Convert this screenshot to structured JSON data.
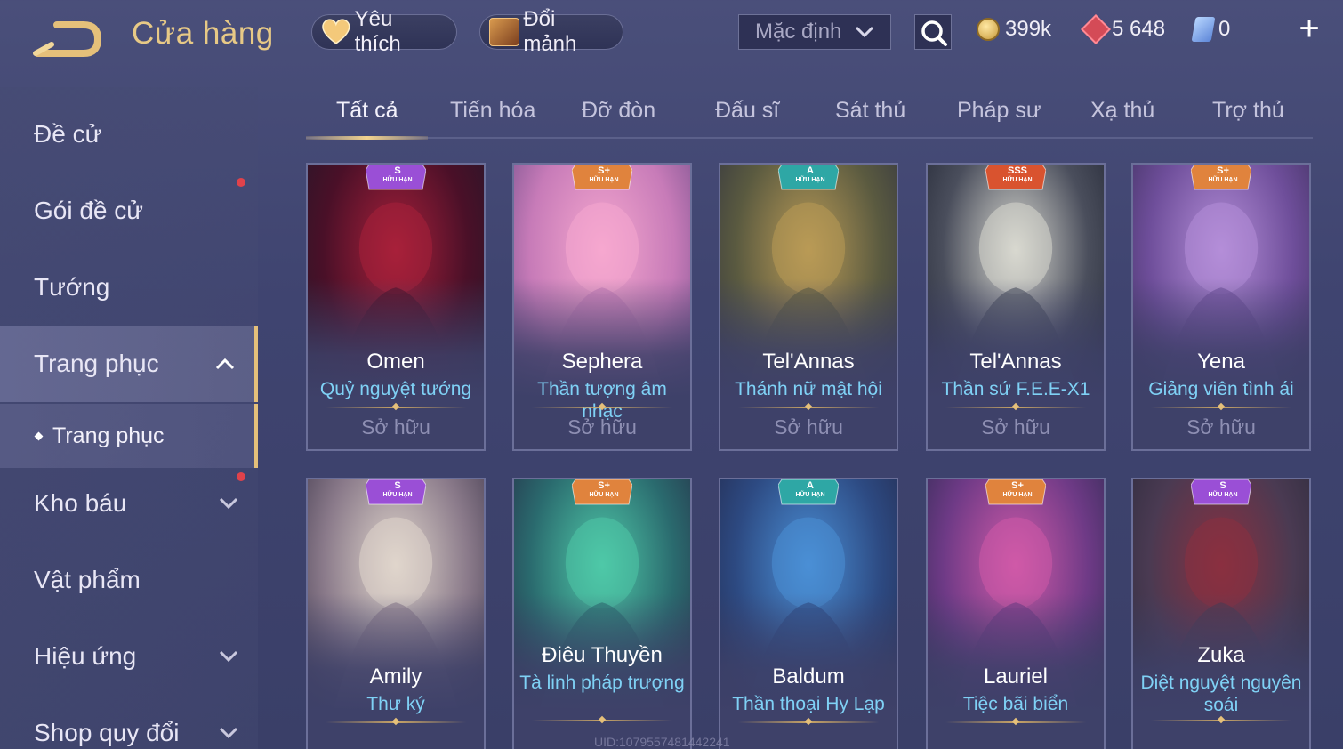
{
  "header": {
    "title": "Cửa hàng",
    "favorite_label": "Yêu thích",
    "exchange_label": "Đổi mảnh",
    "sort_label": "Mặc định",
    "currencies": {
      "gold": "399k",
      "gems": "5 648",
      "vouchers": "0"
    }
  },
  "sidebar": {
    "items": [
      {
        "label": "Đề cử"
      },
      {
        "label": "Gói đề cử"
      },
      {
        "label": "Tướng"
      },
      {
        "label": "Trang phục"
      },
      {
        "label": "Trang phục"
      },
      {
        "label": "Kho báu"
      },
      {
        "label": "Vật phẩm"
      },
      {
        "label": "Hiệu ứng"
      },
      {
        "label": "Shop quy đổi"
      }
    ]
  },
  "tabs": [
    "Tất cả",
    "Tiến hóa",
    "Đỡ đòn",
    "Đấu sĩ",
    "Sát thủ",
    "Pháp sư",
    "Xạ thủ",
    "Trợ thủ"
  ],
  "badge_sub": "HỮU HẠN",
  "cards": [
    {
      "hero": "Omen",
      "skin": "Quỷ nguyệt tướng",
      "status": "Sở hữu",
      "tier": "S",
      "badge_color": "#9a4fd6",
      "palette": [
        "#a8203a",
        "#4a1028",
        "#20182a"
      ]
    },
    {
      "hero": "Sephera",
      "skin": "Thần tượng âm nhạc",
      "status": "Sở hữu",
      "tier": "S+",
      "badge_color": "#e0833d",
      "palette": [
        "#f6a8cf",
        "#c77bb8",
        "#6a4a86"
      ]
    },
    {
      "hero": "Tel'Annas",
      "skin": "Thánh nữ mật hội",
      "status": "Sở hữu",
      "tier": "A",
      "badge_color": "#2ea7a5",
      "palette": [
        "#b99a56",
        "#5a5a40",
        "#2e3040"
      ]
    },
    {
      "hero": "Tel'Annas",
      "skin": "Thần sứ F.E.E-X1",
      "status": "Sở hữu",
      "tier": "SSS",
      "badge_color": "#d9532f",
      "palette": [
        "#d8d8d0",
        "#4a4e5c",
        "#1e2230"
      ]
    },
    {
      "hero": "Yena",
      "skin": "Giảng viên tình ái",
      "status": "Sở hữu",
      "tier": "S+",
      "badge_color": "#e0833d",
      "palette": [
        "#b48ed8",
        "#6e4e9a",
        "#3a2d58"
      ]
    },
    {
      "hero": "Amily",
      "skin": "Thư ký",
      "status": "",
      "tier": "S",
      "badge_color": "#9a4fd6",
      "palette": [
        "#e0d6cc",
        "#8a7a8a",
        "#3a3348"
      ]
    },
    {
      "hero": "Điêu Thuyền",
      "skin": "Tà linh pháp trượng",
      "status": "",
      "tier": "S+",
      "badge_color": "#e0833d",
      "palette": [
        "#4fc9a8",
        "#2a6a6e",
        "#262a44"
      ]
    },
    {
      "hero": "Baldum",
      "skin": "Thần thoại Hy Lạp",
      "status": "",
      "tier": "A",
      "badge_color": "#2ea7a5",
      "palette": [
        "#4a8fd6",
        "#2d4a82",
        "#23284a"
      ]
    },
    {
      "hero": "Lauriel",
      "skin": "Tiệc bãi biển",
      "status": "",
      "tier": "S+",
      "badge_color": "#e0833d",
      "palette": [
        "#d05aa8",
        "#6e3a86",
        "#2a2a4e"
      ]
    },
    {
      "hero": "Zuka",
      "skin": "Diệt nguyệt nguyên soái",
      "status": "",
      "tier": "S",
      "badge_color": "#9a4fd6",
      "palette": [
        "#8a3040",
        "#4a3a52",
        "#2a2a3a"
      ]
    }
  ],
  "uid_text": "UID:1079557481442241"
}
